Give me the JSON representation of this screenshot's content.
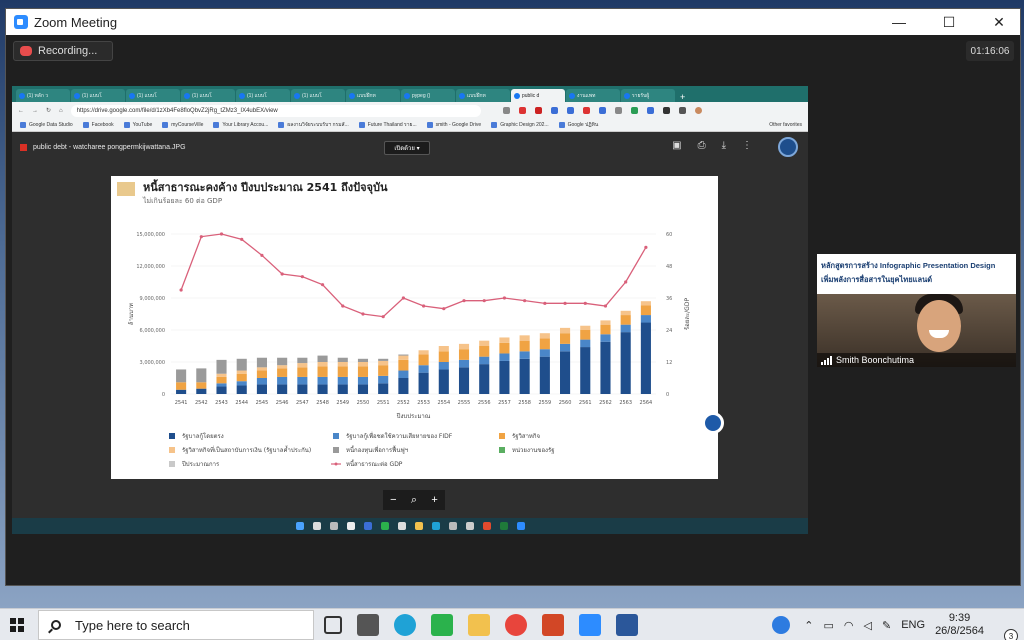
{
  "window": {
    "title": "Zoom Meeting",
    "minimize": "—",
    "maximize": "☐",
    "close": "✕"
  },
  "recording": {
    "label": "Recording..."
  },
  "timer": "01:16:06",
  "browser": {
    "tabs": [
      "(1) หลัก ว",
      "(1) แบบโ",
      "(1) แบบโ",
      "(1) แบบโ",
      "(1) แบบโ",
      "(1) แบบโ",
      "แบบฝึกห",
      "pypeg ()",
      "แบบฝึกห",
      "public d",
      "งานแพท",
      "รายรับผู้"
    ],
    "url": "https://drive.google.com/file/d/1zXb4Fe8floQbvZ2jRg_tZMz3_IX4ubEX/view",
    "bookmarks": [
      "Google Data Studio",
      "Facebook",
      "YouTube",
      "myCourseVille",
      "Your Library Accou...",
      "ผลงานวิจัยระบบรับฯ กรมสั...",
      "Future Thailand ราย...",
      "smith - Google Drive",
      "Graphic Design 202...",
      "Google ปฏิทิน"
    ],
    "other_favorites": "Other favorites"
  },
  "viewer": {
    "filename": "public debt - watcharee pongpermkijwattana.JPG",
    "open_with": "เปิดด้วย",
    "zoom_out": "−",
    "zoom_in": "+"
  },
  "chart_data": {
    "type": "bar",
    "title": "หนี้สาธารณะคงค้าง ปีงบประมาณ 2541 ถึงปัจจุบัน",
    "subtitle": "ไม่เกินร้อยละ 60 ต่อ GDP",
    "xlabel": "ปีงบประมาณ",
    "ylabel": "ล้านบาท",
    "y2label": "ร้อยละ/GDP",
    "ylim": [
      0,
      15000000
    ],
    "y2lim": [
      0,
      60
    ],
    "yticks": [
      "0",
      "3,000,000",
      "6,000,000",
      "9,000,000",
      "12,000,000",
      "15,000,000"
    ],
    "y2ticks": [
      "0",
      "12",
      "24",
      "36",
      "48",
      "60"
    ],
    "categories": [
      "2541",
      "2542",
      "2543",
      "2544",
      "2545",
      "2546",
      "2547",
      "2548",
      "2549",
      "2550",
      "2551",
      "2552",
      "2553",
      "2554",
      "2555",
      "2556",
      "2557",
      "2558",
      "2559",
      "2560",
      "2561",
      "2562",
      "2563",
      "2564"
    ],
    "series": [
      {
        "name": "รัฐบาลกู้โดยตรง",
        "color": "#1f4e8c",
        "values": [
          400000,
          500000,
          700000,
          800000,
          900000,
          900000,
          900000,
          900000,
          900000,
          900000,
          1000000,
          1500000,
          2000000,
          2300000,
          2500000,
          2800000,
          3100000,
          3300000,
          3500000,
          4000000,
          4400000,
          4900000,
          5800000,
          6700000
        ]
      },
      {
        "name": "รัฐบาลกู้เพื่อชดใช้ความเสียหายของ FIDF",
        "color": "#4a86c8",
        "values": [
          0,
          0,
          300000,
          400000,
          600000,
          700000,
          700000,
          700000,
          700000,
          700000,
          700000,
          700000,
          700000,
          700000,
          700000,
          700000,
          700000,
          700000,
          700000,
          700000,
          700000,
          700000,
          700000,
          700000
        ]
      },
      {
        "name": "รัฐวิสาหกิจ",
        "color": "#f0a343",
        "values": [
          700000,
          600000,
          600000,
          700000,
          700000,
          800000,
          900000,
          1000000,
          1000000,
          1000000,
          1000000,
          1000000,
          1000000,
          1000000,
          1000000,
          1000000,
          1000000,
          1000000,
          1000000,
          1000000,
          900000,
          900000,
          900000,
          900000
        ]
      },
      {
        "name": "รัฐวิสาหกิจที่เป็นสถาบันการเงิน (รัฐบาลค้ำประกัน)",
        "color": "#f6c38a",
        "values": [
          0,
          0,
          300000,
          300000,
          300000,
          300000,
          400000,
          400000,
          400000,
          400000,
          400000,
          400000,
          400000,
          500000,
          500000,
          500000,
          500000,
          500000,
          500000,
          500000,
          400000,
          400000,
          400000,
          400000
        ]
      },
      {
        "name": "หนี้กองทุนเพื่อการฟื้นฟูฯ",
        "color": "#9a9a9a",
        "values": [
          1200000,
          1300000,
          1300000,
          1100000,
          900000,
          700000,
          500000,
          600000,
          400000,
          300000,
          200000,
          100000,
          0,
          0,
          0,
          0,
          0,
          0,
          0,
          0,
          0,
          0,
          0,
          0
        ]
      },
      {
        "name": "หน่วยงานของรัฐ",
        "color": "#5aae61",
        "values": [
          0,
          0,
          0,
          0,
          0,
          0,
          0,
          0,
          0,
          0,
          0,
          0,
          0,
          0,
          0,
          0,
          0,
          0,
          0,
          0,
          0,
          0,
          0,
          0
        ]
      },
      {
        "name": "ปีประมาณการ",
        "color": "#c9c9c9",
        "values": [
          0,
          0,
          0,
          0,
          0,
          0,
          0,
          0,
          0,
          0,
          0,
          0,
          0,
          0,
          0,
          0,
          0,
          0,
          0,
          0,
          0,
          0,
          0,
          0
        ]
      }
    ],
    "line": {
      "name": "หนี้สาธารณะต่อ GDP",
      "color": "#d9607a",
      "values": [
        39,
        59,
        60,
        58,
        52,
        45,
        44,
        41,
        33,
        30,
        29,
        36,
        33,
        32,
        35,
        35,
        36,
        35,
        34,
        34,
        34,
        33,
        42,
        55
      ]
    }
  },
  "video": {
    "slide_line1": "หลักสูตรการสร้าง Infographic Presentation Design",
    "slide_line2": "เพิ่มพลังการสื่อสารในยุคไทยแลนด์",
    "name": "Smith Boonchutima"
  },
  "taskbar": {
    "search_placeholder": "Type here to search",
    "lang": "ENG",
    "time": "9:39",
    "date": "26/8/2564",
    "notifications": "3"
  }
}
